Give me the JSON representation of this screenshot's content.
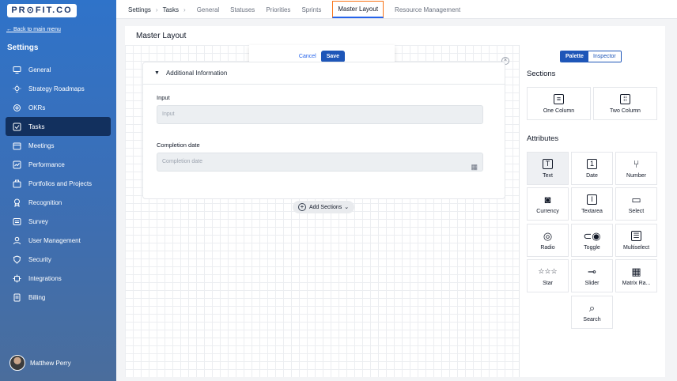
{
  "brand": {
    "logo": "PR⊙FIT.CO"
  },
  "sidebar": {
    "back_link": "← Back to main menu",
    "title": "Settings",
    "items": [
      {
        "label": "General",
        "icon": "monitor-icon"
      },
      {
        "label": "Strategy Roadmaps",
        "icon": "lightbulb-icon"
      },
      {
        "label": "OKRs",
        "icon": "target-icon"
      },
      {
        "label": "Tasks",
        "icon": "checkbox-icon",
        "active": true
      },
      {
        "label": "Meetings",
        "icon": "calendar-icon"
      },
      {
        "label": "Performance",
        "icon": "chart-icon"
      },
      {
        "label": "Portfolios and Projects",
        "icon": "briefcase-icon"
      },
      {
        "label": "Recognition",
        "icon": "award-icon"
      },
      {
        "label": "Survey",
        "icon": "survey-icon"
      },
      {
        "label": "User Management",
        "icon": "user-icon"
      },
      {
        "label": "Security",
        "icon": "shield-icon"
      },
      {
        "label": "Integrations",
        "icon": "plug-icon"
      },
      {
        "label": "Billing",
        "icon": "document-icon"
      }
    ],
    "user_name": "Matthew Perry"
  },
  "topbar": {
    "crumb_settings": "Settings",
    "crumb_tasks": "Tasks",
    "sep": "›",
    "tabs": [
      "General",
      "Statuses",
      "Priorities",
      "Sprints",
      "Master Layout",
      "Resource Management"
    ],
    "active_tab": "Master Layout"
  },
  "main": {
    "title": "Master Layout",
    "actions": {
      "cancel": "Cancel",
      "save": "Save"
    },
    "section": {
      "title": "Additional Information",
      "fields": [
        {
          "label": "Input",
          "placeholder": "Input"
        },
        {
          "label": "Completion date",
          "placeholder": "Completion date"
        }
      ]
    },
    "add_sections": "Add Sections"
  },
  "panel": {
    "toggle": {
      "palette": "Palette",
      "inspector": "Inspector",
      "active": "Palette"
    },
    "sections_heading": "Sections",
    "sections": [
      "One Column",
      "Two Column"
    ],
    "attributes_heading": "Attributes",
    "attributes": [
      "Text",
      "Date",
      "Number",
      "Currency",
      "Textarea",
      "Select",
      "Radio",
      "Toggle",
      "Multiselect",
      "Star",
      "Slider",
      "Matrix Ra...",
      "Search"
    ]
  }
}
